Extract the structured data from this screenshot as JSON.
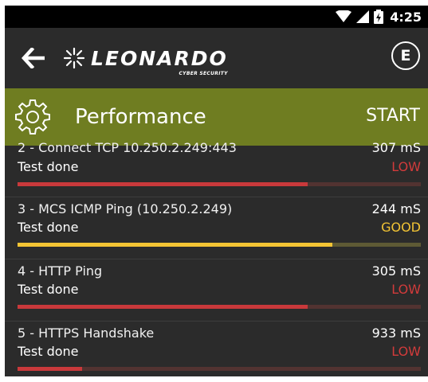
{
  "statusbar": {
    "time": "4:25"
  },
  "appbar": {
    "logo_text": "LEONARDO",
    "logo_sub": "CYBER SECURITY",
    "e_label": "E"
  },
  "header": {
    "title": "Performance",
    "action": "START"
  },
  "colors": {
    "header_bg": "#6f7d21",
    "low": "#d13b3b",
    "good": "#f3c434",
    "bar_low": "#c9393b",
    "bar_good": "#f3c434"
  },
  "tests": [
    {
      "title": "2 - Connect TCP 10.250.2.249:443",
      "status": "Test done",
      "ms": "307 mS",
      "rating": "LOW",
      "level": 0.72
    },
    {
      "title": "3 - MCS ICMP Ping (10.250.2.249)",
      "status": "Test done",
      "ms": "244 mS",
      "rating": "GOOD",
      "level": 0.78
    },
    {
      "title": "4 - HTTP Ping",
      "status": "Test done",
      "ms": "305 mS",
      "rating": "LOW",
      "level": 0.72
    },
    {
      "title": "5 - HTTPS Handshake",
      "status": "Test done",
      "ms": "933 mS",
      "rating": "LOW",
      "level": 0.16
    }
  ]
}
